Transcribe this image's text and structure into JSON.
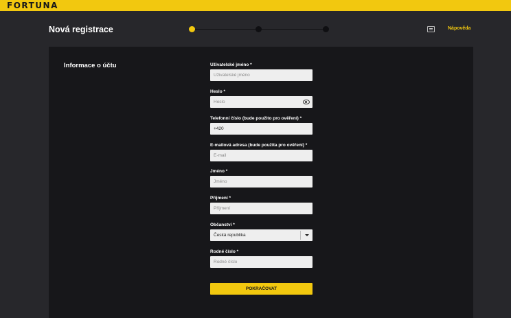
{
  "brand": {
    "logo_text": "FORTUNA",
    "accent_color": "#f2c80f",
    "background_color": "#27272b",
    "panel_color": "#17171a"
  },
  "header": {
    "title": "Nová registrace",
    "help_label": "Nápověda",
    "help_icon": "chat-icon",
    "steps_total": 3,
    "active_step": 1
  },
  "form": {
    "section_title": "Informace o účtu",
    "fields": {
      "username": {
        "label": "Uživatelské jméno *",
        "placeholder": "Uživatelské jméno",
        "value": ""
      },
      "password": {
        "label": "Heslo *",
        "placeholder": "Heslo",
        "value": "",
        "icon": "eye-icon"
      },
      "phone": {
        "label": "Telefonní číslo (bude použito pro ověření) *",
        "placeholder": "",
        "value": "+420"
      },
      "email": {
        "label": "E-mailová adresa (bude použita pro ověření) *",
        "placeholder": "E-mail",
        "value": ""
      },
      "first_name": {
        "label": "Jméno *",
        "placeholder": "Jméno",
        "value": ""
      },
      "last_name": {
        "label": "Příjmení *",
        "placeholder": "Příjmení",
        "value": ""
      },
      "citizenship": {
        "label": "Občanství *",
        "selected": "Česká republika",
        "icon": "chevron-down-icon"
      },
      "birth_number": {
        "label": "Rodné číslo *",
        "placeholder": "Rodné číslo",
        "value": ""
      }
    },
    "submit_label": "POKRAČOVAT"
  }
}
